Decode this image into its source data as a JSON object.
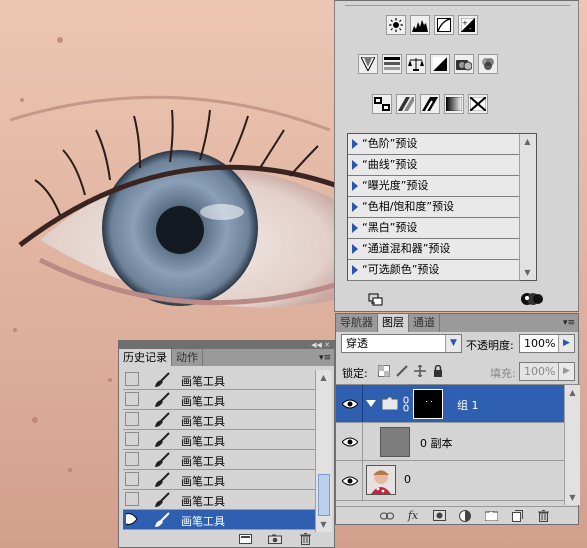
{
  "adjustments": {
    "row1_icons": [
      "brightness-contrast-icon",
      "levels-icon",
      "curves-icon",
      "exposure-icon"
    ],
    "row2_icons": [
      "vibrance-icon",
      "hue-saturation-icon",
      "color-balance-icon",
      "black-white-icon",
      "photo-filter-icon",
      "channel-mixer-icon"
    ],
    "row3_icons": [
      "invert-icon",
      "posterize-icon",
      "threshold-icon",
      "gradient-map-icon",
      "selective-color-icon"
    ],
    "presets": [
      "“色阶”预设",
      "“曲线”预设",
      "“曝光度”预设",
      "“色相/饱和度”预设",
      "“黑白”预设",
      "“通道混和器”预设",
      "“可选颜色”预设"
    ]
  },
  "layers_panel": {
    "tabs": [
      "导航器",
      "图层",
      "通道"
    ],
    "active_tab": "图层",
    "blend_mode": "穿透",
    "opacity_label": "不透明度:",
    "opacity_value": "100%",
    "lock_label": "锁定:",
    "fill_label": "填充:",
    "fill_value": "100%",
    "layers": [
      {
        "name": "组 1",
        "selected": true,
        "type": "group"
      },
      {
        "name": "0 副本",
        "selected": false,
        "type": "layer"
      },
      {
        "name": "0",
        "selected": false,
        "type": "layer"
      }
    ]
  },
  "history_panel": {
    "tabs": [
      "历史记录",
      "动作"
    ],
    "active_tab": "历史记录",
    "items": [
      "画笔工具",
      "画笔工具",
      "画笔工具",
      "画笔工具",
      "画笔工具",
      "画笔工具",
      "画笔工具",
      "画笔工具"
    ],
    "selected_index": 7
  },
  "colors": {
    "selection_blue": "#2f5fb0",
    "panel_gray": "#d4d4d4",
    "accent_blue": "#2a55b0"
  }
}
